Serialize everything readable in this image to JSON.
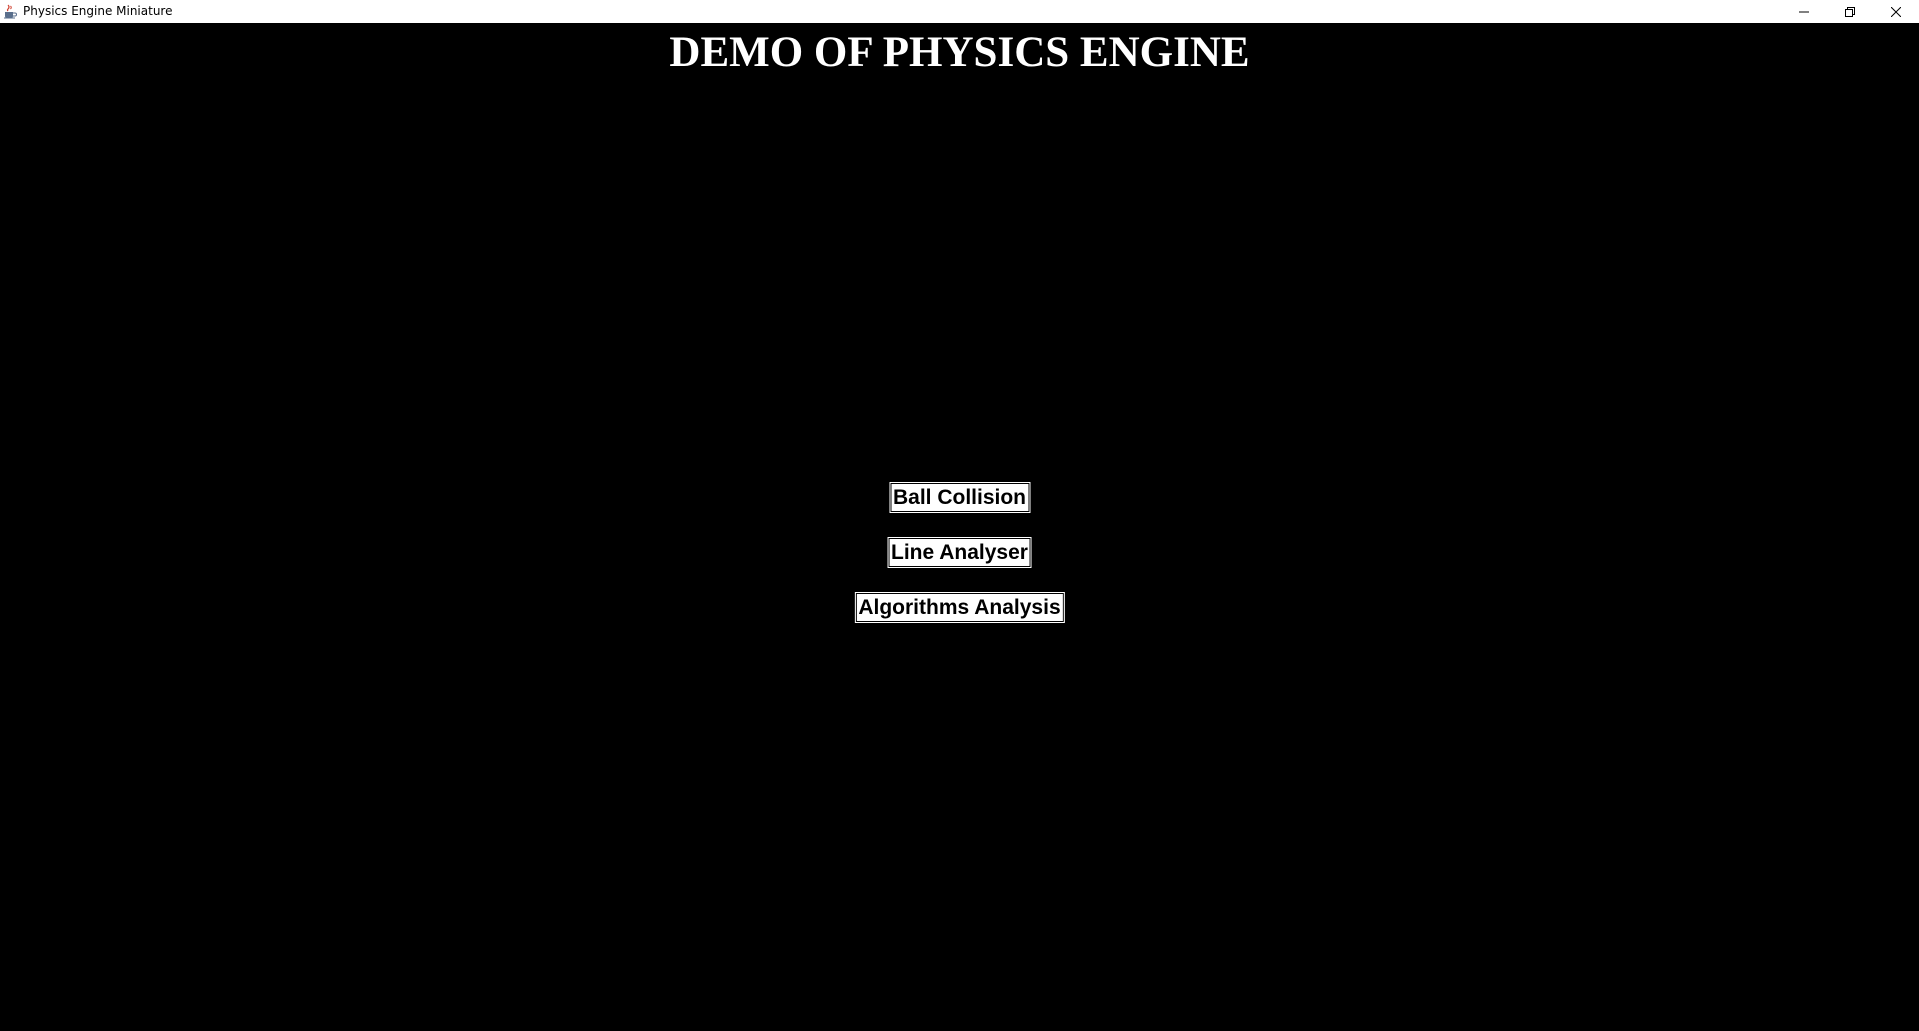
{
  "window": {
    "title": "Physics Engine Miniature",
    "icon": "java-cup-icon",
    "controls": [
      "minimize-icon",
      "restore-icon",
      "close-icon"
    ]
  },
  "main": {
    "heading": "DEMO OF PHYSICS ENGINE",
    "buttons": [
      {
        "label": "Ball Collision"
      },
      {
        "label": "Line Analyser"
      },
      {
        "label": "Algorithms Analysis"
      }
    ]
  },
  "colors": {
    "background": "#000000",
    "titlebar": "#ffffff",
    "heading_text": "#ffffff",
    "button_bg": "#ffffff",
    "button_text": "#000000"
  }
}
